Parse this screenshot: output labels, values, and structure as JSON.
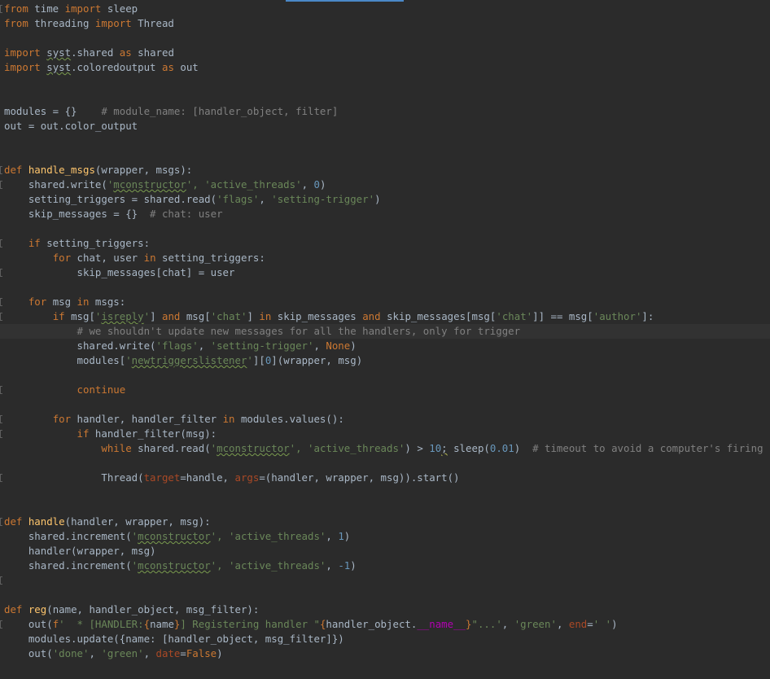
{
  "editor": {
    "current_line": 22,
    "lines": [
      [
        [
          "kw",
          "from"
        ],
        [
          "t",
          " time "
        ],
        [
          "kw",
          "import"
        ],
        [
          "t",
          " sleep"
        ]
      ],
      [
        [
          "kw",
          "from"
        ],
        [
          "t",
          " threading "
        ],
        [
          "kw",
          "import"
        ],
        [
          "t",
          " Thread"
        ]
      ],
      [],
      [
        [
          "kw",
          "import"
        ],
        [
          "t",
          " "
        ],
        [
          "spell",
          "syst"
        ],
        [
          "t",
          ".shared "
        ],
        [
          "kw",
          "as"
        ],
        [
          "t",
          " shared"
        ]
      ],
      [
        [
          "kw",
          "import"
        ],
        [
          "t",
          " "
        ],
        [
          "spell",
          "syst"
        ],
        [
          "t",
          ".coloredoutput "
        ],
        [
          "kw",
          "as"
        ],
        [
          "t",
          " out"
        ]
      ],
      [],
      [],
      [
        [
          "t",
          "modules = {}    "
        ],
        [
          "cmt",
          "# module_name: [handler_object, filter]"
        ]
      ],
      [
        [
          "t",
          "out = out.color_output"
        ]
      ],
      [],
      [],
      [
        [
          "kw",
          "def "
        ],
        [
          "fn",
          "handle_msgs"
        ],
        [
          "t",
          "(wrapper, msgs):"
        ]
      ],
      [
        [
          "t",
          "    shared.write("
        ],
        [
          "str",
          "'"
        ],
        [
          "strsp",
          "mconstructor"
        ],
        [
          "str",
          "', 'active_threads'"
        ],
        [
          "t",
          ", "
        ],
        [
          "num",
          "0"
        ],
        [
          "t",
          ")"
        ]
      ],
      [
        [
          "t",
          "    setting_triggers = shared.read("
        ],
        [
          "str",
          "'flags'"
        ],
        [
          "t",
          ", "
        ],
        [
          "str",
          "'setting-trigger'"
        ],
        [
          "t",
          ")"
        ]
      ],
      [
        [
          "t",
          "    skip_messages = {}  "
        ],
        [
          "cmt",
          "# chat: user"
        ]
      ],
      [],
      [
        [
          "t",
          "    "
        ],
        [
          "kw",
          "if"
        ],
        [
          "t",
          " setting_triggers:"
        ]
      ],
      [
        [
          "t",
          "        "
        ],
        [
          "kw",
          "for"
        ],
        [
          "t",
          " chat, user "
        ],
        [
          "kw",
          "in"
        ],
        [
          "t",
          " setting_triggers:"
        ]
      ],
      [
        [
          "t",
          "            skip_messages[chat] = user"
        ]
      ],
      [],
      [
        [
          "t",
          "    "
        ],
        [
          "kw",
          "for"
        ],
        [
          "t",
          " msg "
        ],
        [
          "kw",
          "in"
        ],
        [
          "t",
          " msgs:"
        ]
      ],
      [
        [
          "t",
          "        "
        ],
        [
          "kw",
          "if"
        ],
        [
          "t",
          " msg["
        ],
        [
          "str",
          "'"
        ],
        [
          "strsp",
          "isreply"
        ],
        [
          "str",
          "'"
        ],
        [
          "t",
          "] "
        ],
        [
          "kw",
          "and"
        ],
        [
          "t",
          " msg["
        ],
        [
          "str",
          "'chat'"
        ],
        [
          "t",
          "] "
        ],
        [
          "kw",
          "in"
        ],
        [
          "t",
          " skip_messages "
        ],
        [
          "kw",
          "and"
        ],
        [
          "t",
          " skip_messages[msg["
        ],
        [
          "str",
          "'chat'"
        ],
        [
          "t",
          "]] == msg["
        ],
        [
          "str",
          "'author'"
        ],
        [
          "t",
          "]:"
        ]
      ],
      [
        [
          "t",
          "            "
        ],
        [
          "cmt",
          "# we shouldn't update new messages for all the handlers, only for trigger"
        ]
      ],
      [
        [
          "t",
          "            shared.write("
        ],
        [
          "str",
          "'flags'"
        ],
        [
          "t",
          ", "
        ],
        [
          "str",
          "'setting-trigger'"
        ],
        [
          "t",
          ", "
        ],
        [
          "kw",
          "None"
        ],
        [
          "t",
          ")"
        ]
      ],
      [
        [
          "t",
          "            modules["
        ],
        [
          "str",
          "'"
        ],
        [
          "strsp",
          "newtriggerslistener"
        ],
        [
          "str",
          "'"
        ],
        [
          "t",
          "]["
        ],
        [
          "num",
          "0"
        ],
        [
          "t",
          "](wrapper, msg)"
        ]
      ],
      [],
      [
        [
          "t",
          "            "
        ],
        [
          "kw",
          "continue"
        ]
      ],
      [],
      [
        [
          "t",
          "        "
        ],
        [
          "kw",
          "for"
        ],
        [
          "t",
          " handler, handler_filter "
        ],
        [
          "kw",
          "in"
        ],
        [
          "t",
          " modules.values():"
        ]
      ],
      [
        [
          "t",
          "            "
        ],
        [
          "kw",
          "if"
        ],
        [
          "t",
          " handler_filter(msg):"
        ]
      ],
      [
        [
          "t",
          "                "
        ],
        [
          "kw",
          "while"
        ],
        [
          "t",
          " shared.read("
        ],
        [
          "str",
          "'"
        ],
        [
          "strsp",
          "mconstructor"
        ],
        [
          "str",
          "', 'active_threads'"
        ],
        [
          "t",
          ") > "
        ],
        [
          "num",
          "10"
        ],
        [
          "warn",
          ";"
        ],
        [
          "t",
          " sleep("
        ],
        [
          "num",
          "0.01"
        ],
        [
          "t",
          ")  "
        ],
        [
          "cmt",
          "# timeout to avoid a computer's firing"
        ]
      ],
      [],
      [
        [
          "t",
          "                Thread("
        ],
        [
          "param",
          "target"
        ],
        [
          "t",
          "=handle, "
        ],
        [
          "param",
          "args"
        ],
        [
          "t",
          "=(handler, wrapper, msg)).start()"
        ]
      ],
      [],
      [],
      [
        [
          "kw",
          "def "
        ],
        [
          "fn",
          "handle"
        ],
        [
          "t",
          "(handler, wrapper, msg):"
        ]
      ],
      [
        [
          "t",
          "    shared.increment("
        ],
        [
          "str",
          "'"
        ],
        [
          "strsp",
          "mconstructor"
        ],
        [
          "str",
          "', 'active_threads'"
        ],
        [
          "t",
          ", "
        ],
        [
          "num",
          "1"
        ],
        [
          "t",
          ")"
        ]
      ],
      [
        [
          "t",
          "    handler(wrapper, msg)"
        ]
      ],
      [
        [
          "t",
          "    shared.increment("
        ],
        [
          "str",
          "'"
        ],
        [
          "strsp",
          "mconstructor"
        ],
        [
          "str",
          "', 'active_threads'"
        ],
        [
          "t",
          ", "
        ],
        [
          "num",
          "-1"
        ],
        [
          "t",
          ")"
        ]
      ],
      [],
      [],
      [
        [
          "kw",
          "def "
        ],
        [
          "fn",
          "reg"
        ],
        [
          "t",
          "(name, handler_object, msg_filter):"
        ]
      ],
      [
        [
          "t",
          "    out("
        ],
        [
          "kw",
          "f"
        ],
        [
          "str",
          "'  * [HANDLER:"
        ],
        [
          "kw",
          "{"
        ],
        [
          "t",
          "name"
        ],
        [
          "kw",
          "}"
        ],
        [
          "str",
          "] Registering handler \""
        ],
        [
          "kw",
          "{"
        ],
        [
          "t",
          "handler_object."
        ],
        [
          "dunder",
          "__name__"
        ],
        [
          "kw",
          "}"
        ],
        [
          "str",
          "\"...'"
        ],
        [
          "t",
          ", "
        ],
        [
          "str",
          "'green'"
        ],
        [
          "t",
          ", "
        ],
        [
          "param",
          "end"
        ],
        [
          "t",
          "="
        ],
        [
          "str",
          "' '"
        ],
        [
          "t",
          ")"
        ]
      ],
      [
        [
          "t",
          "    modules.update({name: [handler_object, msg_filter]})"
        ]
      ],
      [
        [
          "t",
          "    out("
        ],
        [
          "str",
          "'done'"
        ],
        [
          "t",
          ", "
        ],
        [
          "str",
          "'green'"
        ],
        [
          "t",
          ", "
        ],
        [
          "param",
          "date"
        ],
        [
          "t",
          "="
        ],
        [
          "kw",
          "False"
        ],
        [
          "t",
          ")"
        ]
      ]
    ],
    "fold_lines": [
      0,
      11,
      12,
      16,
      18,
      20,
      21,
      26,
      28,
      29,
      32,
      35,
      39,
      42,
      45
    ],
    "colors": {
      "background": "#2b2b2b",
      "text": "#a9b7c6",
      "keyword": "#cc7832",
      "string": "#6a8759",
      "number": "#6897bb",
      "comment": "#808080",
      "function": "#ffc66d",
      "parameter": "#aa4926"
    }
  }
}
